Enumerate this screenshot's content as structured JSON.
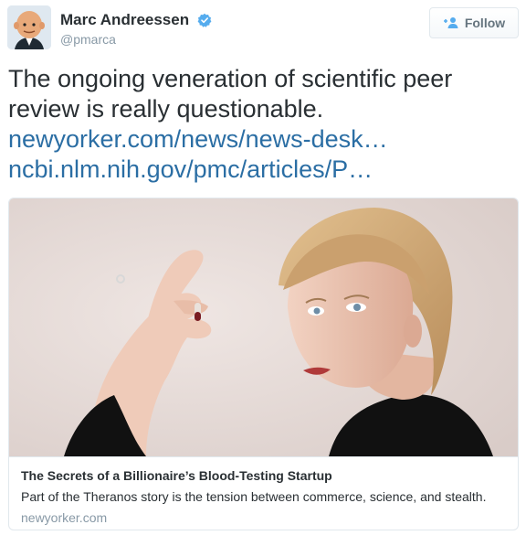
{
  "tweet": {
    "author": {
      "name": "Marc Andreessen",
      "handle": "@pmarca",
      "verified": true
    },
    "follow_button": {
      "label": "Follow",
      "icon": "add-user-icon"
    },
    "text": "The ongoing veneration of scientific peer review is really questionable.",
    "text_lines": [
      "The ongoing veneration of scientific peer",
      "review is really questionable."
    ],
    "links": [
      "newyorker.com/news/news-desk…",
      "ncbi.nlm.nih.gov/pmc/articles/P…"
    ],
    "card": {
      "title": "The Secrets of a Billionaire’s Blood-Testing Startup",
      "description": "Part of the Theranos story is the tension between commerce, science, and stealth.",
      "domain": "newyorker.com"
    }
  },
  "colors": {
    "link": "#2b6ea4",
    "text": "#292f33",
    "muted": "#8899a6",
    "verified": "#55acee",
    "border": "#e1e8ed"
  }
}
